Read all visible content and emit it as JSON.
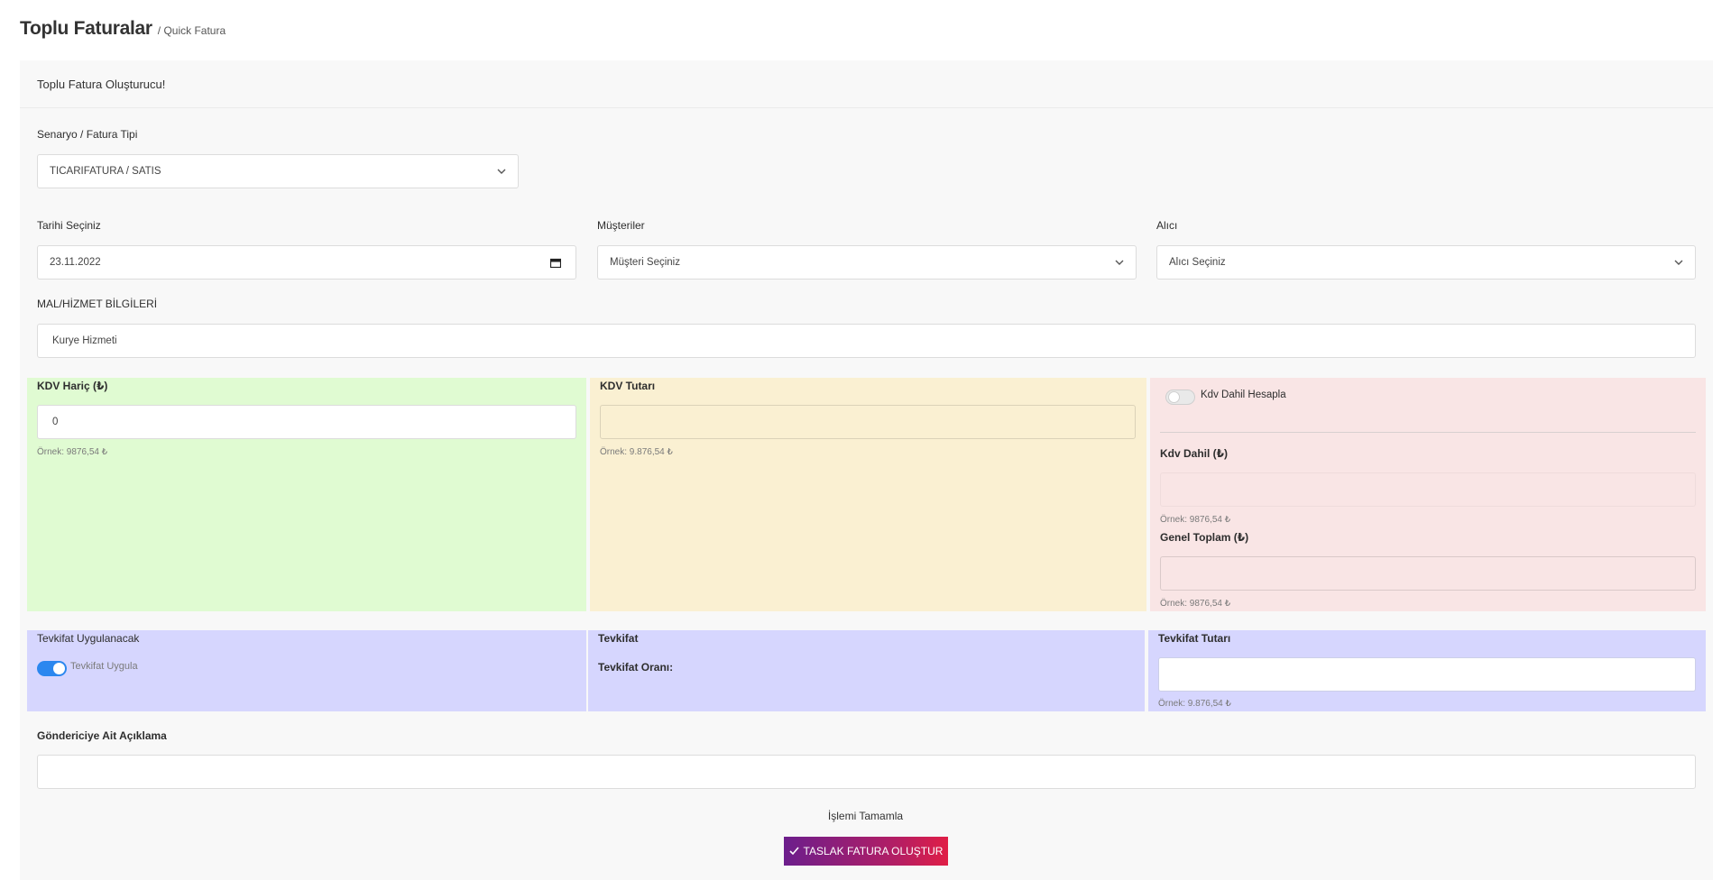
{
  "header": {
    "title": "Toplu Faturalar",
    "subtitle": "/ Quick Fatura"
  },
  "card": {
    "title": "Toplu Fatura Oluşturucu!"
  },
  "scenario": {
    "label": "Senaryo / Fatura Tipi",
    "value": "TICARIFATURA / SATIS"
  },
  "date": {
    "label": "Tarihi Seçiniz",
    "value": "23.11.2022"
  },
  "customers": {
    "label": "Müşteriler",
    "value": "Müşteri Seçiniz"
  },
  "recipient": {
    "label": "Alıcı",
    "value": "Alıcı Seçiniz"
  },
  "goods": {
    "label": "MAL/HİZMET BİLGİLERİ",
    "value": "Kurye Hizmeti"
  },
  "kdv_haric": {
    "label": "KDV Hariç (₺)",
    "value": "0",
    "hint": "Örnek: 9876,54 ₺"
  },
  "kdv_tutari": {
    "label": "KDV Tutarı",
    "value": "",
    "hint": "Örnek: 9.876,54 ₺"
  },
  "kdv_dahil_toggle": {
    "label": "Kdv Dahil Hesapla",
    "on": false
  },
  "kdv_dahil": {
    "label": "Kdv Dahil (₺)",
    "value": "",
    "hint": "Örnek: 9876,54 ₺"
  },
  "genel_toplam": {
    "label": "Genel Toplam (₺)",
    "value": "",
    "hint": "Örnek: 9876,54 ₺"
  },
  "tevkifat_apply": {
    "label": "Tevkifat Uygulanacak",
    "toggle_label": "Tevkifat Uygula",
    "on": true
  },
  "tevkifat": {
    "label": "Tevkifat",
    "rate_label": "Tevkifat Oranı:"
  },
  "tevkifat_tutari": {
    "label": "Tevkifat Tutarı",
    "value": "",
    "hint": "Örnek: 9.876,54 ₺"
  },
  "sender_note": {
    "label": "Göndericiye Ait Açıklama",
    "value": ""
  },
  "complete": {
    "label": "İşlemi Tamamla",
    "button": "TASLAK FATURA OLUŞTUR"
  },
  "colors": {
    "green": "#e0fbd2",
    "yellow": "#faf0d2",
    "red": "#f9e5e5",
    "blue": "#d6d6fe",
    "toggle_on": "#2b87ef",
    "button_start": "#6c1e8c",
    "button_end": "#e01e46"
  },
  "icons": {
    "select": "chevron-down-icon",
    "date": "calendar-icon",
    "button": "check-icon"
  }
}
